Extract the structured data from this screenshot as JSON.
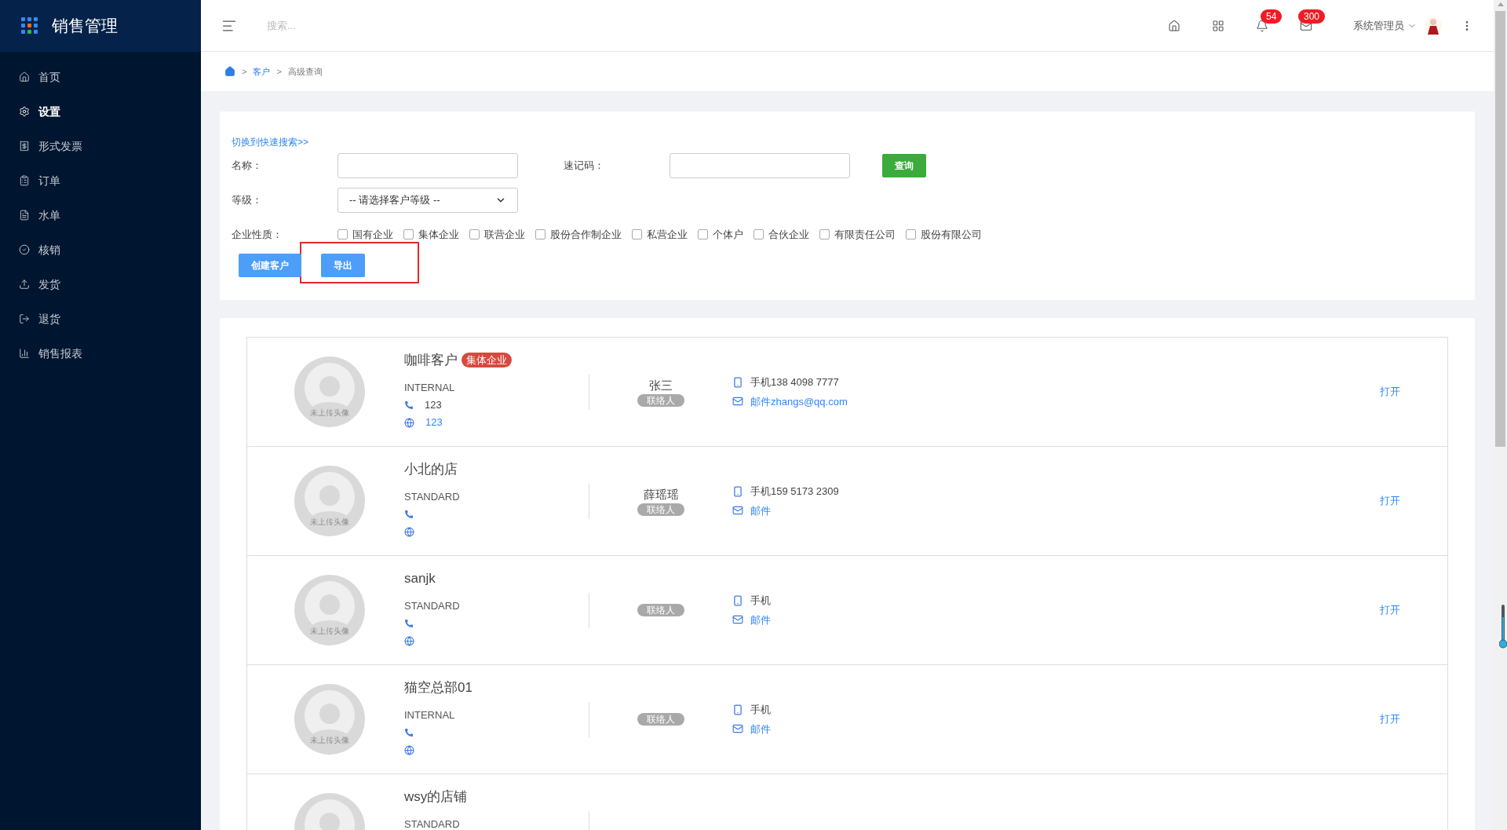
{
  "app": {
    "title": "销售管理"
  },
  "sidebar": {
    "items": [
      {
        "label": "首页",
        "selected": false
      },
      {
        "label": "设置",
        "selected": true
      },
      {
        "label": "形式发票",
        "selected": false
      },
      {
        "label": "订单",
        "selected": false
      },
      {
        "label": "水单",
        "selected": false
      },
      {
        "label": "核销",
        "selected": false
      },
      {
        "label": "发货",
        "selected": false
      },
      {
        "label": "退货",
        "selected": false
      },
      {
        "label": "销售报表",
        "selected": false
      }
    ]
  },
  "topbar": {
    "search": {
      "placeholder": "搜索..."
    },
    "notifications_badge": "54",
    "messages_badge": "300",
    "user": "系统管理员"
  },
  "breadcrumb": [
    {
      "separator": ">",
      "label": "客户"
    },
    {
      "separator": ">",
      "label": "高级查询"
    }
  ],
  "search_panel": {
    "toggle_link": "切换到快速搜索>>",
    "fields": [
      {
        "label": "名称："
      },
      {
        "label": "速记码："
      }
    ],
    "query_button": "查询",
    "level": {
      "label": "等级：",
      "placeholder": "-- 请选择客户等级 --"
    },
    "nature": {
      "label": "企业性质：",
      "options": [
        {
          "label": "国有企业",
          "checked": false
        },
        {
          "label": "集体企业",
          "checked": false
        },
        {
          "label": "联营企业",
          "checked": false
        },
        {
          "label": "股份合作制企业",
          "checked": false
        },
        {
          "label": "私营企业",
          "checked": false
        },
        {
          "label": "个体户",
          "checked": false
        },
        {
          "label": "合伙企业",
          "checked": false
        },
        {
          "label": "有限责任公司",
          "checked": false
        },
        {
          "label": "股份有限公司",
          "checked": false
        }
      ]
    },
    "buttons": [
      {
        "label": "创建客户",
        "highlighted": false
      },
      {
        "label": "导出",
        "highlighted": true
      }
    ]
  },
  "customers": [
    {
      "avatar_text": "未上传头像",
      "name": "咖啡客户",
      "tag": "集体企业",
      "level": "INTERNAL",
      "phone": "123",
      "website": "123",
      "contact": "张三",
      "contact_role": "联络人",
      "mobile": "手机138 4098 7777",
      "email": "邮件zhangs@qq.com",
      "action": "打开"
    },
    {
      "avatar_text": "未上传头像",
      "name": "小北的店",
      "level": "STANDARD",
      "contact": "薛瑶瑶",
      "contact_role": "联络人",
      "mobile": "手机159 5173 2309",
      "email": "邮件",
      "action": "打开"
    },
    {
      "avatar_text": "未上传头像",
      "name": "sanjk",
      "level": "STANDARD",
      "contact_role": "联络人",
      "mobile": "手机",
      "email": "邮件",
      "action": "打开"
    },
    {
      "avatar_text": "未上传头像",
      "name": "猫空总部01",
      "level": "INTERNAL",
      "contact_role": "联络人",
      "mobile": "手机",
      "email": "邮件",
      "action": "打开"
    },
    {
      "name": "wsy的店铺",
      "level": "STANDARD"
    }
  ]
}
